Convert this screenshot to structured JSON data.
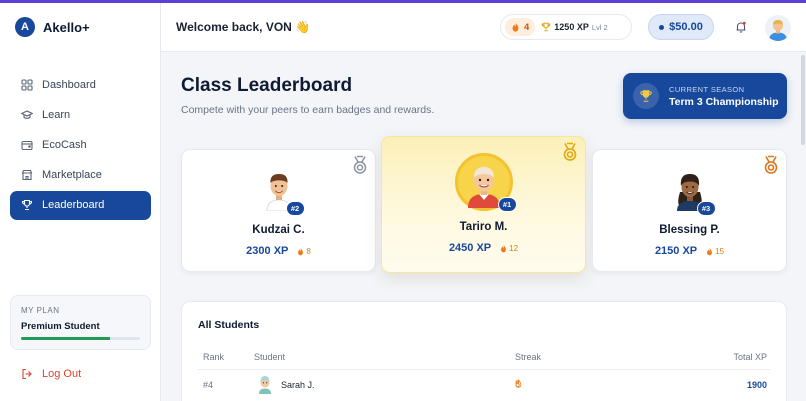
{
  "app": {
    "name": "Akello+",
    "logo_letter": "A"
  },
  "sidebar": {
    "items": [
      {
        "label": "Dashboard",
        "icon": "grid-icon",
        "active": false
      },
      {
        "label": "Learn",
        "icon": "graduation-cap-icon",
        "active": false
      },
      {
        "label": "EcoCash",
        "icon": "wallet-icon",
        "active": false
      },
      {
        "label": "Marketplace",
        "icon": "store-icon",
        "active": false
      },
      {
        "label": "Leaderboard",
        "icon": "trophy-icon",
        "active": true
      }
    ],
    "plan": {
      "title": "MY PLAN",
      "name": "Premium Student",
      "progress": 0.75
    },
    "logout_label": "Log Out"
  },
  "header": {
    "welcome": "Welcome back, VON 👋",
    "streak": "4",
    "xp": "1250 XP",
    "level": "Lvl 2",
    "balance": "$50.00"
  },
  "page": {
    "title": "Class Leaderboard",
    "subtitle": "Compete with your peers to earn badges and rewards.",
    "season_label": "CURRENT SEASON",
    "season_name": "Term 3 Championship"
  },
  "podium": {
    "second": {
      "rank": "#2",
      "name": "Kudzai C.",
      "xp": "2300 XP",
      "streak": "8"
    },
    "first": {
      "rank": "#1",
      "name": "Tariro M.",
      "xp": "2450 XP",
      "streak": "12"
    },
    "third": {
      "rank": "#3",
      "name": "Blessing P.",
      "xp": "2150 XP",
      "streak": "15"
    }
  },
  "students": {
    "title": "All Students",
    "columns": {
      "rank": "Rank",
      "student": "Student",
      "streak": "Streak",
      "xp": "Total XP"
    },
    "rows": [
      {
        "rank": "#4",
        "name": "Sarah J.",
        "streak": "5",
        "xp": "1900"
      }
    ]
  },
  "colors": {
    "primary": "#17489b",
    "accent_orange": "#e07a16",
    "gold": "#f2c230",
    "danger": "#e0442c"
  }
}
